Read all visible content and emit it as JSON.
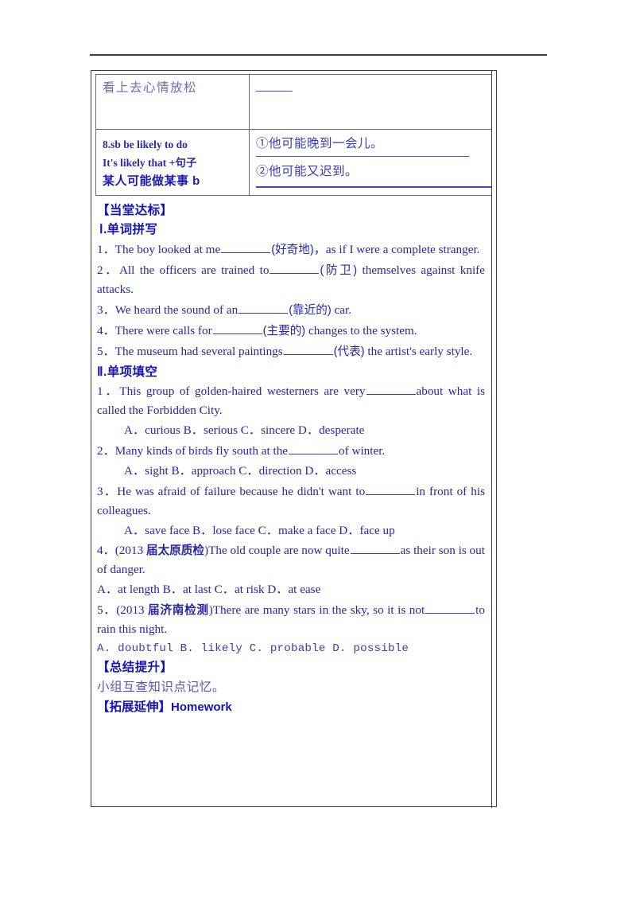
{
  "table": {
    "rows": [
      {
        "left_cn": "看上去心情放松",
        "right_blank": true
      },
      {
        "left_lines": [
          "8.sb be likely to do",
          "It's likely that +句子",
          "某人可能做某事  b"
        ],
        "answers": [
          {
            "marker": "①",
            "text": "他可能晚到一会儿。"
          },
          {
            "marker": "②",
            "text": "他可能又迟到。"
          }
        ]
      }
    ]
  },
  "sections": {
    "practice_heading": "【当堂达标】",
    "part1_heading": "Ⅰ.单词拼写",
    "part2_heading": "Ⅱ.单项填空",
    "summary_heading": "【总结提升】",
    "summary_text": "小组互查知识点记忆。",
    "homework_heading": "【拓展延伸】",
    "homework_label": "Homework"
  },
  "spelling": [
    {
      "num": "1．",
      "pre": "The boy looked at me",
      "hint": "(好奇地)",
      "post": "，as if I were a complete stranger."
    },
    {
      "num": "2．",
      "pre": "All the officers are trained to",
      "hint": "(防卫)",
      "post": " themselves against knife attacks."
    },
    {
      "num": "3．",
      "pre": "We heard the sound of an",
      "hint": "(靠近的)",
      "post": " car."
    },
    {
      "num": "4．",
      "pre": "There were calls for",
      "hint": "(主要的)",
      "post": " changes to the system."
    },
    {
      "num": "5．",
      "pre": "The museum had several paintings",
      "hint": "(代表)",
      "post": " the artist's early style."
    }
  ],
  "choice": [
    {
      "num": "1．",
      "source": "",
      "pre": "This group of golden-haired westerners are very",
      "post": "about what is called the Forbidden City.",
      "options": "A．curious  B．serious  C．sincere  D．desperate",
      "options_indent": true,
      "options_mono": false
    },
    {
      "num": "2．",
      "source": "",
      "pre": "Many kinds of birds fly south at the",
      "post": "of winter.",
      "options": "A．sight  B．approach  C．direction  D．access",
      "options_indent": true,
      "options_mono": false
    },
    {
      "num": "3．",
      "source": "",
      "pre": "He was afraid of failure because he didn't want to",
      "post": "in front of his colleagues.",
      "options": "A．save face  B．lose face  C．make a face  D．face up",
      "options_indent": true,
      "options_mono": false
    },
    {
      "num": "4．",
      "source": "(2013 届太原质检)",
      "source_cn": "届太原质检",
      "pre": "The old couple are now quite",
      "post": "as their son is out of danger.",
      "options": "A．at length  B．at last  C．at risk  D．at ease",
      "options_indent": false,
      "options_mono": false
    },
    {
      "num": "5．",
      "source": "(2013 届济南检测)",
      "source_cn": "届济南检测",
      "pre": "There are many stars in the sky, so it is not",
      "post": "to rain this night.",
      "options": "A. doubtful  B. likely  C. probable  D. possible",
      "options_indent": false,
      "options_mono": true
    }
  ]
}
